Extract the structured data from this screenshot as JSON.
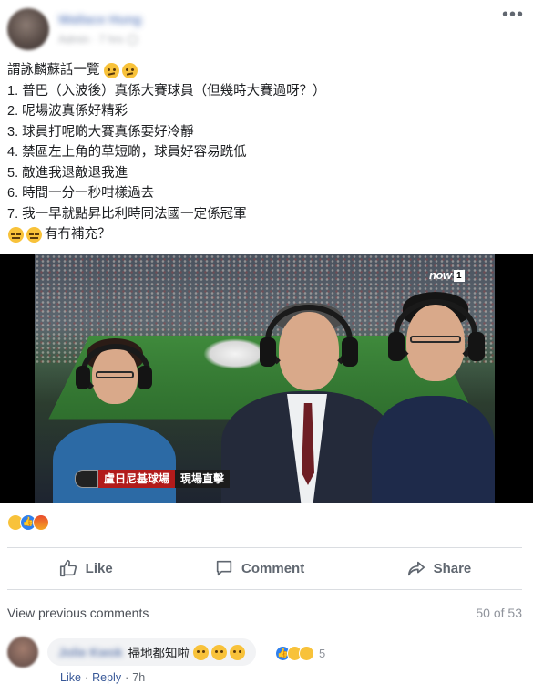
{
  "post": {
    "author_name": "Wallace Hung",
    "meta_time": "Admin · 7 hrs",
    "more_icon": "more-horizontal-icon",
    "lines": [
      "謂詠麟蘇話一覽",
      "1. 普巴（入波後）真係大賽球員（但幾時大賽過呀？）",
      "2. 呢場波真係好精彩",
      "3. 球員打呢啲大賽真係要好冷靜",
      "4. 禁區左上角的草短啲，球員好容易跣低",
      "5. 敵進我退敵退我進",
      "6. 時間一分一秒咁樣過去",
      "7. 我一早就點昇比利時同法國一定係冠軍",
      "有冇補充？"
    ]
  },
  "photo": {
    "broadcaster": "now",
    "broadcaster_badge": "1",
    "caption_left": "盧日尼基球場",
    "caption_right": "現場直擊"
  },
  "reactions": [
    "haha",
    "like",
    "angry"
  ],
  "actions": {
    "like": "Like",
    "comment": "Comment",
    "share": "Share"
  },
  "comments_bar": {
    "view_previous": "View previous comments",
    "count": "50 of 53"
  },
  "comment": {
    "author": "Jolie Kwok",
    "text": "掃地都知啦",
    "reaction_count": "5",
    "like_link": "Like",
    "reply_link": "Reply",
    "time": "7h"
  },
  "colors": {
    "link_blue": "#385898",
    "text": "#1c1e21",
    "muted": "#606770",
    "divider": "#dadde1",
    "banner_red": "#b21b1b"
  }
}
